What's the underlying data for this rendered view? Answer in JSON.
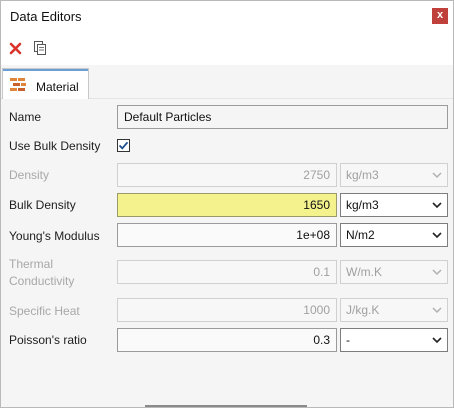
{
  "window": {
    "title": "Data Editors",
    "close_glyph": "x"
  },
  "toolbar": {
    "delete_icon": "delete-icon",
    "copy_icon": "copy-icon"
  },
  "tab": {
    "label": "Material",
    "icon": "material-brick-icon"
  },
  "form": {
    "name": {
      "label": "Name",
      "value": "Default Particles"
    },
    "use_bulk_density": {
      "label": "Use Bulk Density",
      "checked": true
    },
    "density": {
      "label": "Density",
      "value": "2750",
      "unit": "kg/m3",
      "enabled": false
    },
    "bulk_density": {
      "label": "Bulk Density",
      "value": "1650",
      "unit": "kg/m3",
      "enabled": true
    },
    "youngs_modulus": {
      "label": "Young's Modulus",
      "value": "1e+08",
      "unit": "N/m2",
      "enabled": true
    },
    "thermal_conductivity": {
      "label_line1": "Thermal",
      "label_line2": "Conductivity",
      "value": "0.1",
      "unit": "W/m.K",
      "enabled": false
    },
    "specific_heat": {
      "label": "Specific Heat",
      "value": "1000",
      "unit": "J/kg.K",
      "enabled": false
    },
    "poissons_ratio": {
      "label": "Poisson's ratio",
      "value": "0.3",
      "unit": "-",
      "enabled": true
    }
  },
  "colors": {
    "highlight": "#f4f28c",
    "close": "#c0413c",
    "tab_accent": "#6aa0d6",
    "delete_red": "#d9332b"
  }
}
